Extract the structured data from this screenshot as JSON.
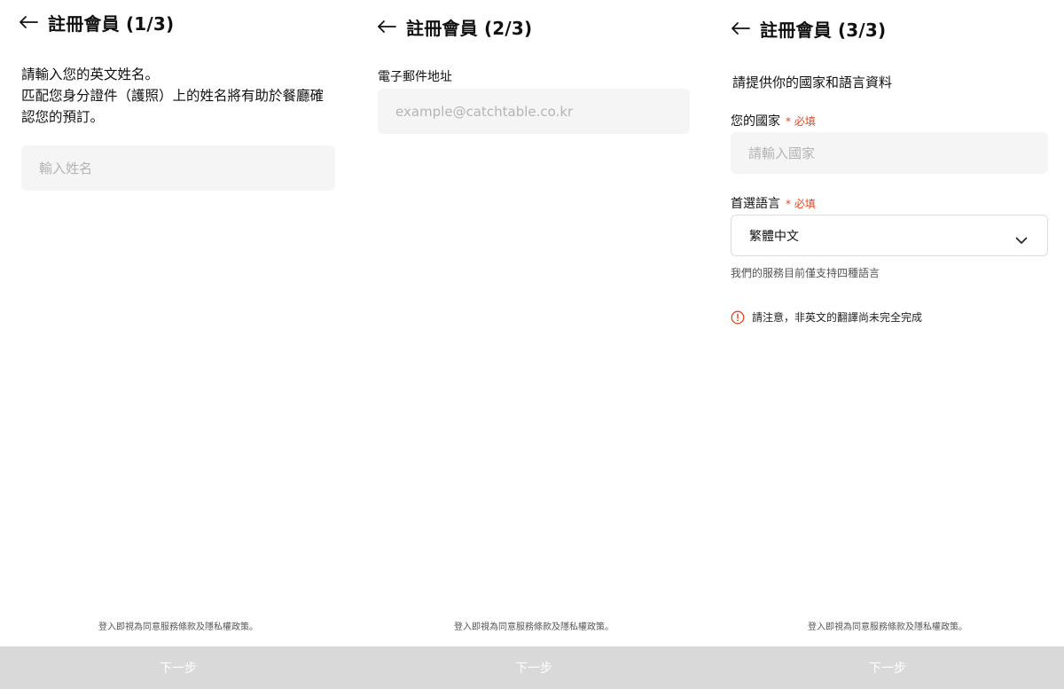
{
  "screen1": {
    "title": "註冊會員 (1/3)",
    "intro_line1": "請輸入您的英文姓名。",
    "intro_line2": "匹配您身分證件（護照）上的姓名將有助於餐廳確",
    "intro_line3": "認您的預訂。",
    "name_placeholder": "輸入姓名",
    "terms": "登入即視為同意服務條款及隱私權政策。",
    "next_label": "下一步"
  },
  "screen2": {
    "title": "註冊會員 (2/3)",
    "email_label": "電子郵件地址",
    "email_placeholder": "example@catchtable.co.kr",
    "terms": "登入即視為同意服務條款及隱私權政策。",
    "next_label": "下一步"
  },
  "screen3": {
    "title": "註冊會員 (3/3)",
    "intro": "請提供你的國家和語言資料",
    "country_label": "您的國家",
    "country_required": "* 必填",
    "country_placeholder": "請輸入國家",
    "language_label": "首選語言",
    "language_required": "* 必填",
    "language_value": "繁體中文",
    "helper": "我們的服務目前僅支持四種語言",
    "notice": "請注意，非英文的翻譯尚未完全完成",
    "terms": "登入即視為同意服務條款及隱私權政策。",
    "next_label": "下一步"
  },
  "colors": {
    "required": "#e5461f",
    "input_bg": "#f5f5f5",
    "button_bg": "#d9d9d9",
    "alert": "#e5461f"
  },
  "icons": {
    "back": "arrow-left-icon",
    "chevron": "chevron-down-icon",
    "alert": "alert-circle-icon"
  }
}
